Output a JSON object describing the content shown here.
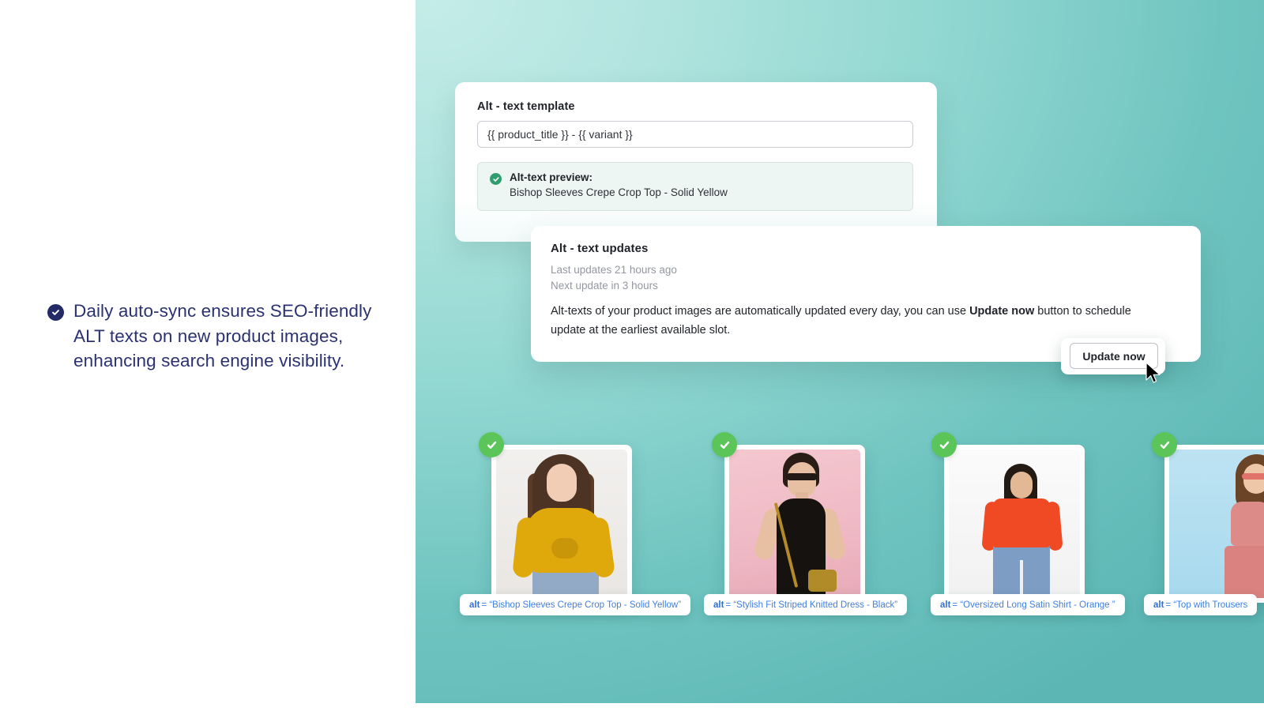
{
  "feature": {
    "bullet_icon": "check-circle-icon",
    "text": "Daily auto-sync ensures SEO-friendly ALT texts on new product images, enhancing search engine visibility.",
    "icon_color": "#232a66",
    "text_color": "#2b3271"
  },
  "template_card": {
    "title": "Alt - text template",
    "input_value": "{{ product_title }} - {{ variant }}",
    "input_placeholder": "{{ product_title }} - {{ variant }}",
    "preview_icon": "check-circle-icon",
    "preview_label": "Alt-text preview:",
    "preview_value": "Bishop Sleeves Crepe Crop Top - Solid Yellow",
    "preview_icon_color": "#2f9e6f"
  },
  "updates_card": {
    "title": "Alt - text updates",
    "last_update": "Last updates 21 hours ago",
    "next_update": "Next update in 3 hours",
    "body_part_1": "Alt-texts of your product images are automatically updated every day, you can use ",
    "body_emphasis": "Update now",
    "body_part_2": " button to schedule update at the earliest available slot."
  },
  "update_button": {
    "label": "Update now",
    "cursor_icon": "mouse-pointer-icon"
  },
  "products": [
    {
      "badge_icon": "check-circle-icon",
      "alt_prefix": "alt",
      "alt_equals": "=",
      "alt_value": "“Bishop Sleeves Crepe Crop Top - Solid Yellow”",
      "image_description": "Model in yellow bishop sleeves crepe crop top"
    },
    {
      "badge_icon": "check-circle-icon",
      "alt_prefix": "alt",
      "alt_equals": "=",
      "alt_value": "“Stylish Fit Striped Knitted Dress - Black”",
      "image_description": "Model in black knitted dress with gold bag on pink background"
    },
    {
      "badge_icon": "check-circle-icon",
      "alt_prefix": "alt",
      "alt_equals": "=",
      "alt_value": "“Oversized Long Satin Shirt - Orange ”",
      "image_description": "Model in orange satin shirt and blue jeans"
    },
    {
      "badge_icon": "check-circle-icon",
      "alt_prefix": "alt",
      "alt_equals": "=",
      "alt_value": "“Top with Trousers",
      "image_description": "Model in pink top with trousers on light blue background"
    }
  ],
  "colors": {
    "stage_gradient_start": "#c4ece8",
    "stage_gradient_end": "#5cb6b4",
    "badge_green": "#5cc55a",
    "alt_pill_text": "#3f7fe0",
    "panel_background": "#ffffff"
  }
}
